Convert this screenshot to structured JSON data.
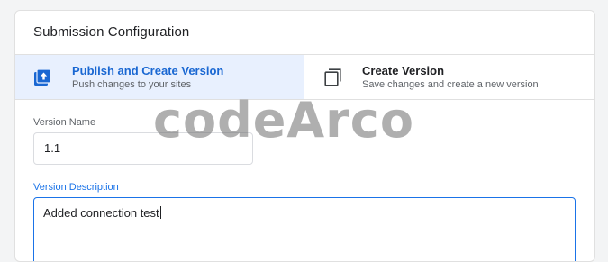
{
  "card": {
    "title": "Submission Configuration"
  },
  "options": [
    {
      "label": "Publish and Create Version",
      "sub": "Push changes to your sites",
      "icon": "publish-icon",
      "selected": true
    },
    {
      "label": "Create Version",
      "sub": "Save changes and create a new version",
      "icon": "copy-icon",
      "selected": false
    }
  ],
  "form": {
    "version_name_label": "Version Name",
    "version_name_value": "1.1",
    "version_description_label": "Version Description",
    "version_description_value": "Added connection test"
  },
  "watermark": "codeArco",
  "colors": {
    "accent": "#1a73e8",
    "selected_bg": "#e8f0fe",
    "selected_text": "#1967d2"
  }
}
